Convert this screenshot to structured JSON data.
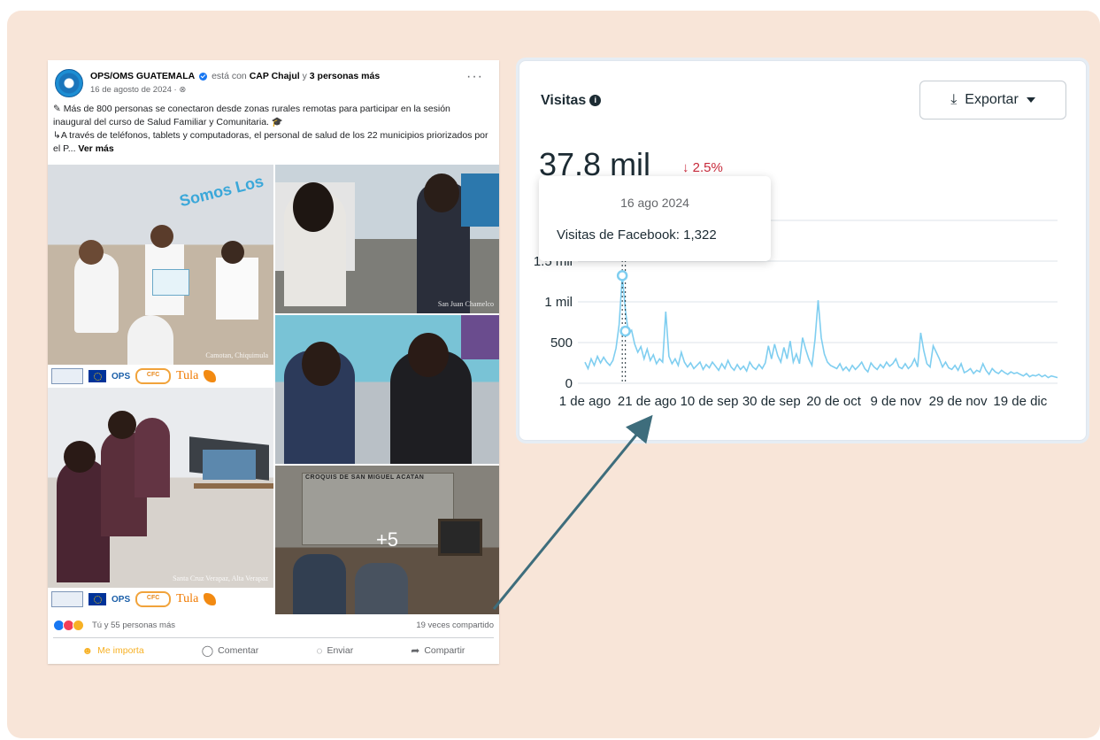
{
  "post": {
    "author": "OPS/OMS GUATEMALA",
    "with_text": "está con",
    "tagged_place": "CAP Chajul",
    "and_text": "y",
    "tagged_people": "3 personas más",
    "date": "16 de agosto de 2024 · ",
    "more_label": "···",
    "text_line1": "Más de 800 personas se conectaron desde zonas rurales remotas para participar en la sesión inaugural del curso de Salud Familiar y Comunitaria.",
    "text_line2": "A través de teléfonos, tablets y computadoras, el personal de salud de los 22 municipios priorizados por el P...",
    "see_more": "Ver más",
    "photo_captions": [
      "Camotan, Chiquimula",
      "San Juan Chamelco",
      "Santa Cruz Verapaz, Alta Verapaz"
    ],
    "logos": {
      "ops": "OPS",
      "cf": "CFC",
      "tula": "Tula"
    },
    "wall_map_text": "CROQUIS DE SAN MIGUEL ACATAN",
    "banner_text": "Somos Los",
    "plus_more": "+5",
    "reaction_names": "Tú y 55 personas más",
    "shares": "19 veces compartido",
    "actions": {
      "react": "Me importa",
      "comment": "Comentar",
      "send": "Enviar",
      "share": "Compartir"
    }
  },
  "panel": {
    "title": "Visitas",
    "export_label": "Exportar",
    "total": "37.8 mil",
    "delta": "↓ 2.5%",
    "tooltip": {
      "date": "16 ago 2024",
      "label": "Visitas de Facebook: 1,322"
    }
  },
  "chart_data": {
    "type": "line",
    "title": "Visitas",
    "y_tick_labels": [
      "0",
      "500",
      "1 mil",
      "1.5 mil"
    ],
    "y_ticks": [
      0,
      500,
      1000,
      1500
    ],
    "x_tick_labels": [
      "1 de ago",
      "21 de ago",
      "10 de sep",
      "30 de sep",
      "20 de oct",
      "9 de nov",
      "29 de nov",
      "19 de dic"
    ],
    "ylim": [
      0,
      2000
    ],
    "x_days": 153,
    "series": [
      {
        "name": "Visitas de Facebook",
        "color": "#7fcef0",
        "values": [
          260,
          180,
          300,
          220,
          330,
          250,
          320,
          260,
          220,
          280,
          430,
          720,
          1322,
          900,
          610,
          650,
          480,
          380,
          450,
          300,
          420,
          280,
          350,
          240,
          300,
          260,
          880,
          330,
          240,
          300,
          220,
          380,
          260,
          200,
          250,
          180,
          220,
          260,
          170,
          230,
          190,
          260,
          210,
          160,
          240,
          180,
          280,
          200,
          160,
          230,
          170,
          210,
          150,
          260,
          200,
          170,
          230,
          180,
          250,
          460,
          300,
          480,
          340,
          260,
          440,
          300,
          520,
          260,
          360,
          240,
          560,
          420,
          300,
          220,
          540,
          1020,
          560,
          360,
          260,
          220,
          200,
          180,
          240,
          160,
          200,
          150,
          220,
          170,
          210,
          260,
          180,
          140,
          250,
          200,
          170,
          230,
          190,
          260,
          210,
          240,
          300,
          200,
          180,
          240,
          180,
          220,
          300,
          200,
          620,
          400,
          240,
          200,
          460,
          380,
          300,
          200,
          260,
          190,
          170,
          220,
          160,
          240,
          130,
          150,
          180,
          120,
          160,
          140,
          240,
          160,
          110,
          180,
          140,
          120,
          160,
          130,
          110,
          140,
          120,
          130,
          110,
          90,
          120,
          80,
          100,
          90,
          110,
          80,
          100,
          70,
          90,
          80,
          70
        ]
      }
    ],
    "highlight": {
      "x": 12,
      "value": 1322,
      "date": "16 ago 2024"
    },
    "secondary_marker": {
      "x": 13,
      "value": 640
    },
    "grid": true
  }
}
